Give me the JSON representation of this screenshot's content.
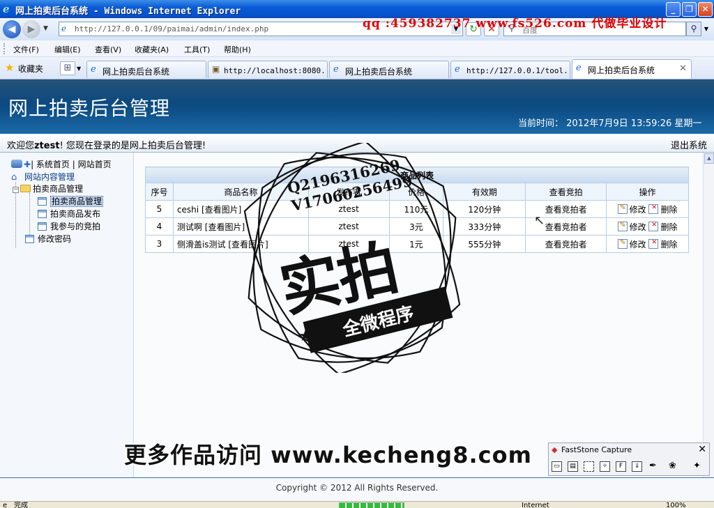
{
  "window": {
    "title": "网上拍卖后台系统 - Windows Internet Explorer",
    "minimize": "_",
    "restore": "❐",
    "close": "✕"
  },
  "address_bar": {
    "url": "http://127.0.0.1/09/paimai/admin/index.php",
    "search_placeholder": "百度"
  },
  "overlay_top_text": "qq :459382737 www.fs526.com 代做毕业设计",
  "menu": {
    "items": [
      "文件(F)",
      "编辑(E)",
      "查看(V)",
      "收藏夹(A)",
      "工具(T)",
      "帮助(H)"
    ]
  },
  "favorites": {
    "label": "收藏夹"
  },
  "tabs": [
    {
      "title": "网上拍卖后台系统",
      "icon": "ie-page-icon"
    },
    {
      "title": "http://localhost:8080...",
      "icon": "image-icon"
    },
    {
      "title": "网上拍卖后台系统",
      "icon": "ie-page-icon"
    },
    {
      "title": "http://127.0.0.1/tool...",
      "icon": "ie-page-icon"
    },
    {
      "title": "网上拍卖后台系统",
      "icon": "ie-page-icon",
      "active": true
    }
  ],
  "header": {
    "site_title": "网上拍卖后台管理",
    "current_time": "当前时间： 2012年7月9日 13:59:26 星期一"
  },
  "welcome": {
    "prefix": "欢迎您",
    "user": "ztest",
    "suffix": "! 您现在登录的是网上拍卖后台管理!",
    "logout": "退出系统"
  },
  "sidebar": {
    "top_links": "| 系统首页 | 网站首页",
    "site_content": "网站内容管理",
    "folder": "拍卖商品管理",
    "children": [
      "拍卖商品管理",
      "拍卖商品发布",
      "我参与的竞拍"
    ],
    "change_password": "修改密码"
  },
  "goods_table": {
    "caption": "商品列表",
    "headers": [
      "序号",
      "商品名称",
      "发布者",
      "价格",
      "有效期",
      "查看竞拍",
      "操作"
    ],
    "rows": [
      {
        "id": "5",
        "name": "ceshi [查看图片]",
        "publisher": "ztest",
        "price": "110元",
        "validity": "120分钟",
        "bidders": "查看竞拍者",
        "edit": "修改",
        "delete": "删除"
      },
      {
        "id": "4",
        "name": "测试啊 [查看图片]",
        "publisher": "ztest",
        "price": "3元",
        "validity": "333分钟",
        "bidders": "查看竞拍者",
        "edit": "修改",
        "delete": "删除"
      },
      {
        "id": "3",
        "name": "侧滑盖is测试 [查看图片]",
        "publisher": "ztest",
        "price": "1元",
        "validity": "555分钟",
        "bidders": "查看竞拍者",
        "edit": "修改",
        "delete": "删除"
      }
    ]
  },
  "footer": {
    "copyright": "Copyright © 2012 All Rights Reserved."
  },
  "watermark": {
    "qq": "Q2196316269",
    "vx": "V17060256499",
    "big": "实拍",
    "banner": "全微程序",
    "promo": "更多作品访问 www.kecheng8.com"
  },
  "faststone": {
    "title": "FastStone Capture",
    "close": "✕"
  },
  "statusbar": {
    "status": "完成",
    "zone": "Internet",
    "zoom": "100%"
  },
  "colors": {
    "header_dark": "#073a68",
    "header_light": "#1b6aa8",
    "qq_overlay": "#e00000"
  }
}
